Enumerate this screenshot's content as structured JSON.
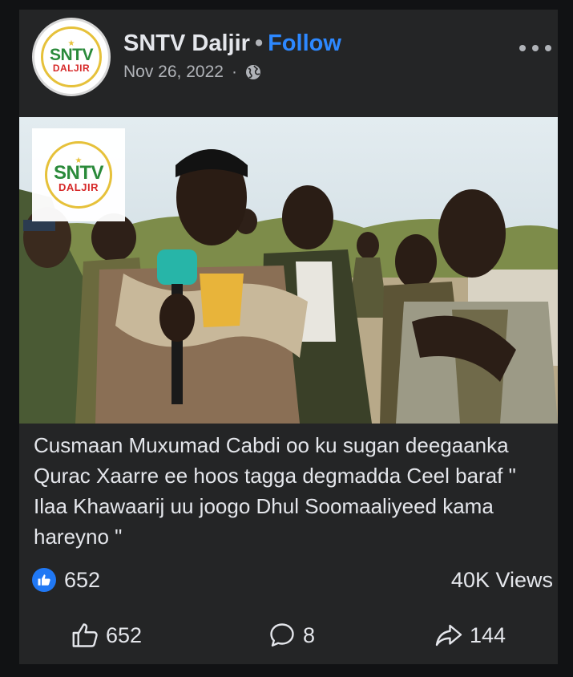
{
  "post": {
    "page_name": "SNTV Daljir",
    "separator": "•",
    "follow_label": "Follow",
    "date": "Nov 26, 2022",
    "meta_separator": "·",
    "privacy_icon": "globe-icon",
    "more_icon": "more-options-icon",
    "logo": {
      "line1": "SNTV",
      "line2": "DALJIR"
    },
    "media": {
      "overlay_logo": {
        "line1": "SNTV",
        "line2": "DALJIR"
      }
    },
    "caption": "Cusmaan Muxumad Cabdi oo ku sugan deegaanka Qurac Xaarre ee hoos tagga degmadda Ceel baraf \" Ilaa Khawaarij uu joogo Dhul Soomaaliyeed kama hareyno \"",
    "reactions_count": "652",
    "views": "40K Views"
  },
  "actions": {
    "like_count": "652",
    "comment_count": "8",
    "share_count": "144"
  },
  "colors": {
    "background": "#111214",
    "card": "#242526",
    "text": "#e4e6eb",
    "secondary_text": "#b0b3b8",
    "accent": "#2d88ff",
    "like_badge": "#2078f4"
  }
}
